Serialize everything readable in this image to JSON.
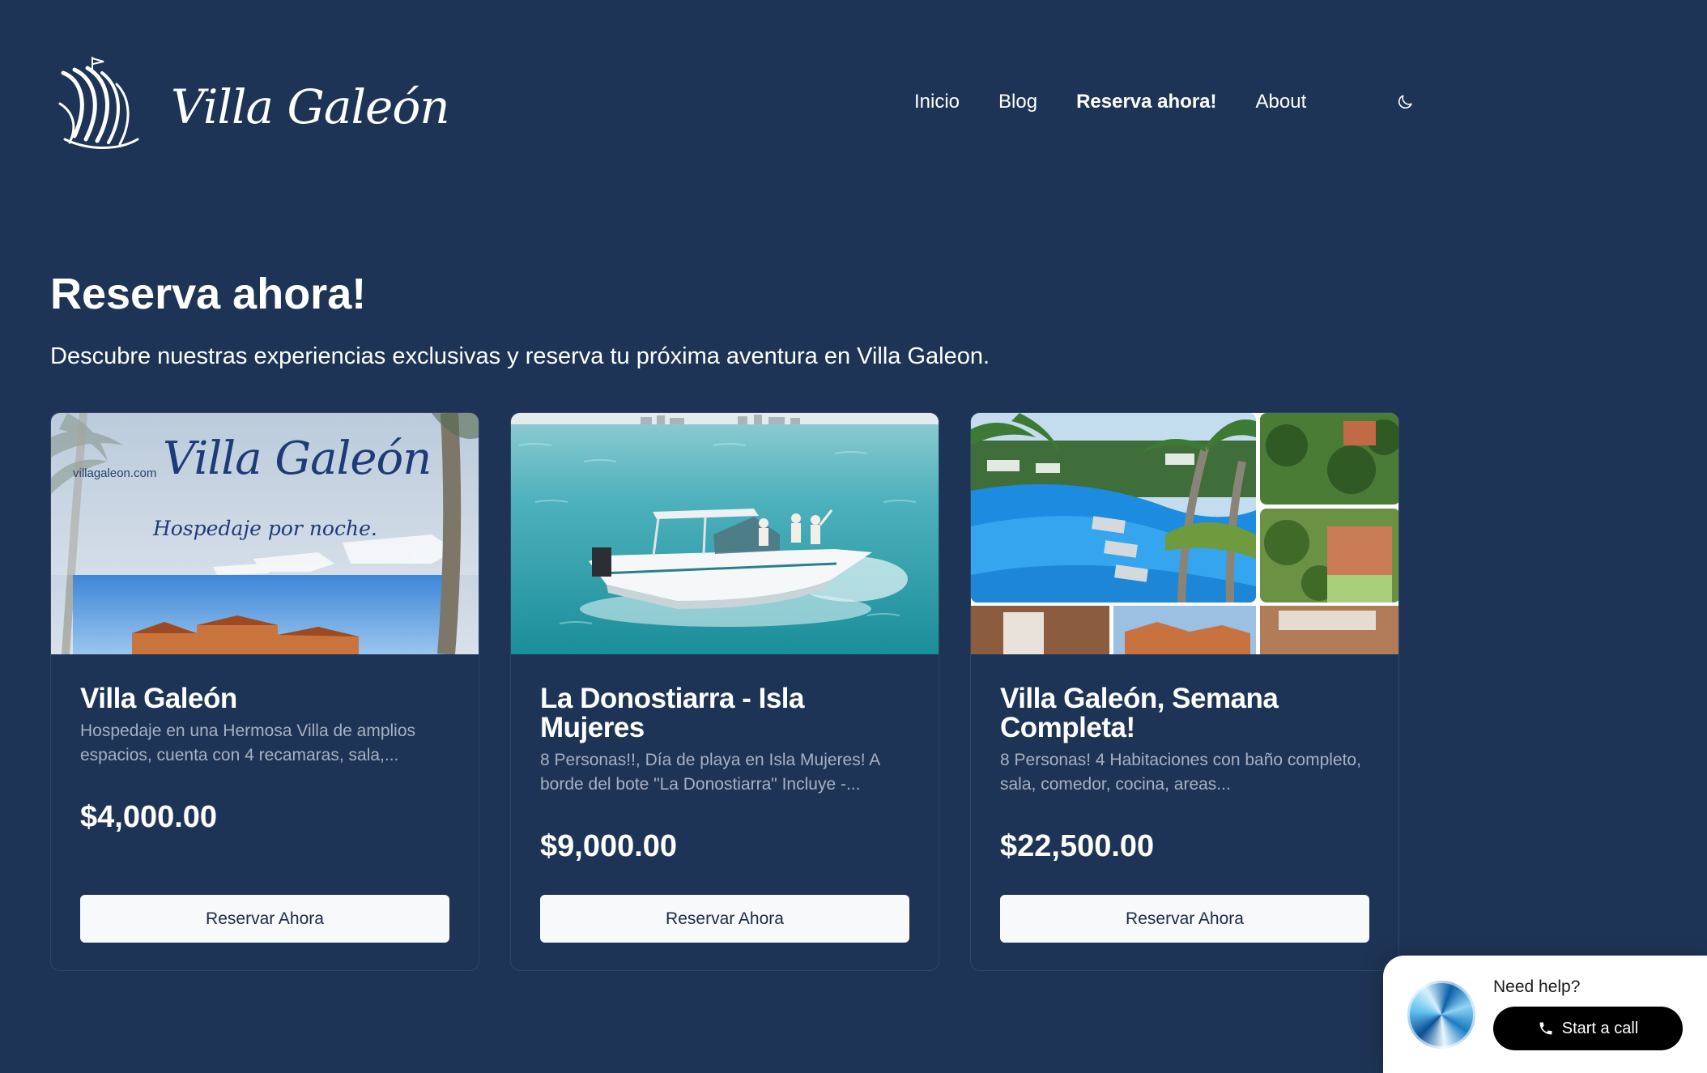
{
  "brand": {
    "name": "Villa Galeón",
    "logo_icon": "ship-icon"
  },
  "nav": {
    "items": [
      {
        "label": "Inicio",
        "active": false
      },
      {
        "label": "Blog",
        "active": false
      },
      {
        "label": "Reserva ahora!",
        "active": true
      },
      {
        "label": "About",
        "active": false
      }
    ],
    "theme_toggle_icon": "moon-icon"
  },
  "page": {
    "title": "Reserva ahora!",
    "subtitle": "Descubre nuestras experiencias exclusivas y reserva tu próxima aventura en Villa Galeon."
  },
  "cards": [
    {
      "title": "Villa Galeón",
      "description": "Hospedaje en una Hermosa Villa de amplios espacios, cuenta con 4 recamaras, sala,...",
      "price": "$4,000.00",
      "button_label": "Reservar Ahora",
      "image": {
        "overlay_site": "villagaleon.com",
        "overlay_title": "Villa Galeón",
        "overlay_tagline": "Hospedaje por noche."
      }
    },
    {
      "title": "La Donostiarra - Isla Mujeres",
      "description": "8 Personas!!, Día de playa en Isla Mujeres! A borde del bote \"La Donostiarra\" Incluye -...",
      "price": "$9,000.00",
      "button_label": "Reservar Ahora"
    },
    {
      "title": "Villa Galeón, Semana Completa!",
      "description": "8 Personas! 4 Habitaciones con baño completo, sala, comedor, cocina, areas...",
      "price": "$22,500.00",
      "button_label": "Reservar Ahora"
    }
  ],
  "help_widget": {
    "prompt": "Need help?",
    "button_label": "Start a call",
    "button_icon": "phone-icon"
  },
  "colors": {
    "background": "#1e3456",
    "text": "#ffffff",
    "muted_text": "#a6b1c3",
    "button_bg": "#f8f9fb",
    "button_text": "#1c2a44",
    "help_button_bg": "#000000"
  }
}
